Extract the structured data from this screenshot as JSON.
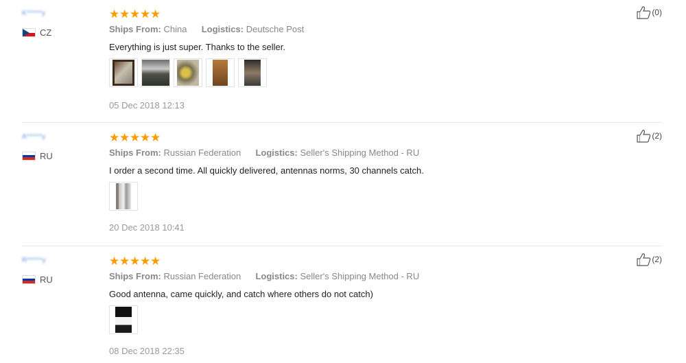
{
  "labels": {
    "ships_from": "Ships From:",
    "logistics": "Logistics:"
  },
  "colors": {
    "star": "#ff9a00",
    "username": "#5b8fd6"
  },
  "reviews": [
    {
      "username": "K*****y",
      "country_code": "CZ",
      "flag": "flag-cz",
      "rating": 5,
      "ships_from": "China",
      "logistics": "Deutsche Post",
      "text": "Everything is just super. Thanks to the seller.",
      "photos": [
        "photo-1",
        "photo-2",
        "photo-3",
        "photo-4",
        "photo-5"
      ],
      "date": "05 Dec 2018 12:13",
      "likes": "(0)"
    },
    {
      "username": "A*****y",
      "country_code": "RU",
      "flag": "flag-ru",
      "rating": 5,
      "ships_from": "Russian Federation",
      "logistics": "Seller's Shipping Method - RU",
      "text": "I order a second time. All quickly delivered, antennas norms, 30 channels catch.",
      "photos": [
        "photo-1"
      ],
      "date": "20 Dec 2018 10:41",
      "likes": "(2)"
    },
    {
      "username": "R*****y",
      "country_code": "RU",
      "flag": "flag-ru",
      "rating": 5,
      "ships_from": "Russian Federation",
      "logistics": "Seller's Shipping Method - RU",
      "text": "Good antenna, came quickly, and catch where others do not catch)",
      "photos": [
        "photo-1"
      ],
      "date": "08 Dec 2018 22:35",
      "likes": "(2)"
    }
  ]
}
